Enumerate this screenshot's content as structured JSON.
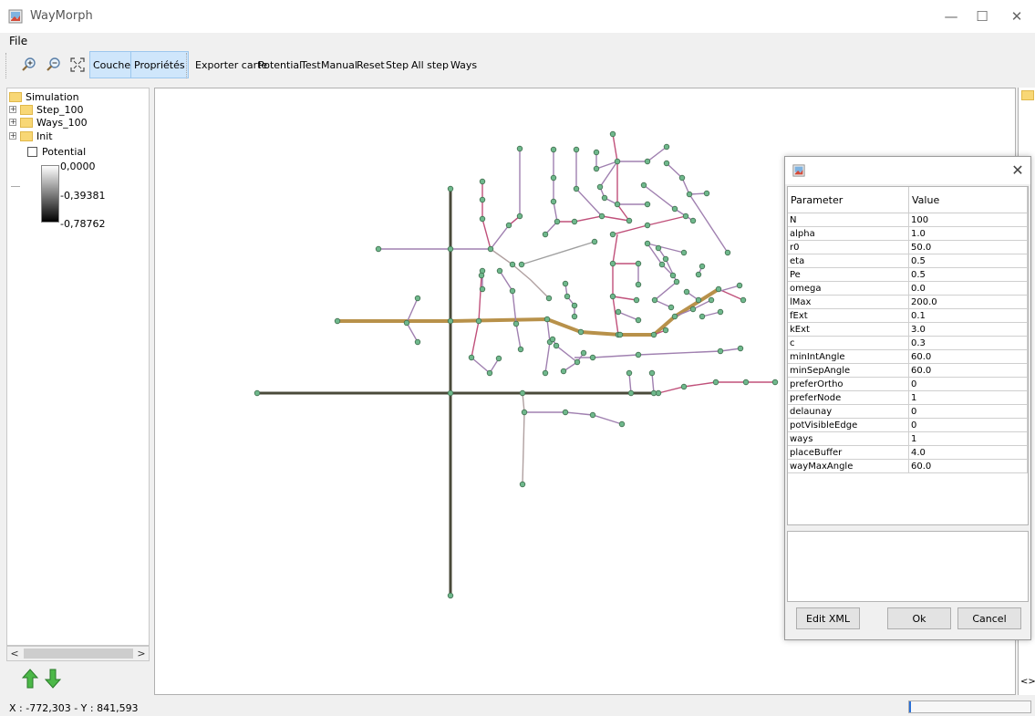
{
  "window": {
    "title": "WayMorph",
    "minimize": "—",
    "maximize": "☐",
    "close": "✕"
  },
  "menu": {
    "file": "File"
  },
  "toolbar": {
    "zoom_in": "zoom-in-icon",
    "zoom_out": "zoom-out-icon",
    "fit": "fit-extent-icon",
    "couches": "Couches",
    "proprietes": "Propriétés",
    "actions": [
      "Exporter carte",
      "Potential",
      "Test",
      "Manual",
      "Reset",
      "Step",
      "All step",
      "Ways"
    ]
  },
  "tree": {
    "root": "Simulation",
    "items": [
      "Step_100",
      "Ways_100",
      "Init"
    ],
    "layer": "Potential",
    "legend": [
      "0,0000",
      "-0,39381",
      "-0,78762"
    ]
  },
  "status": {
    "coords": "X : -772,303 - Y : 841,593"
  },
  "dialog": {
    "close": "✕",
    "headers": {
      "param": "Parameter",
      "value": "Value"
    },
    "rows": [
      [
        "N",
        "100"
      ],
      [
        "alpha",
        "1.0"
      ],
      [
        "r0",
        "50.0"
      ],
      [
        "eta",
        "0.5"
      ],
      [
        "Pe",
        "0.5"
      ],
      [
        "omega",
        "0.0"
      ],
      [
        "lMax",
        "200.0"
      ],
      [
        "fExt",
        "0.1"
      ],
      [
        "kExt",
        "3.0"
      ],
      [
        "c",
        "0.3"
      ],
      [
        "minIntAngle",
        "60.0"
      ],
      [
        "minSepAngle",
        "60.0"
      ],
      [
        "preferOrtho",
        "0"
      ],
      [
        "preferNode",
        "1"
      ],
      [
        "delaunay",
        "0"
      ],
      [
        "potVisibleEdge",
        "0"
      ],
      [
        "ways",
        "1"
      ],
      [
        "placeBuffer",
        "4.0"
      ],
      [
        "wayMaxAngle",
        "60.0"
      ]
    ],
    "buttons": {
      "edit_xml": "Edit XML",
      "ok": "Ok",
      "cancel": "Cancel"
    }
  },
  "colors": {
    "highlight": "#cfe6fb",
    "node": "#6fb88c",
    "main_road": "#4a4a3a",
    "way": "#b8914a",
    "edge_pink": "#c0507a",
    "edge_mauve": "#a080b0"
  }
}
